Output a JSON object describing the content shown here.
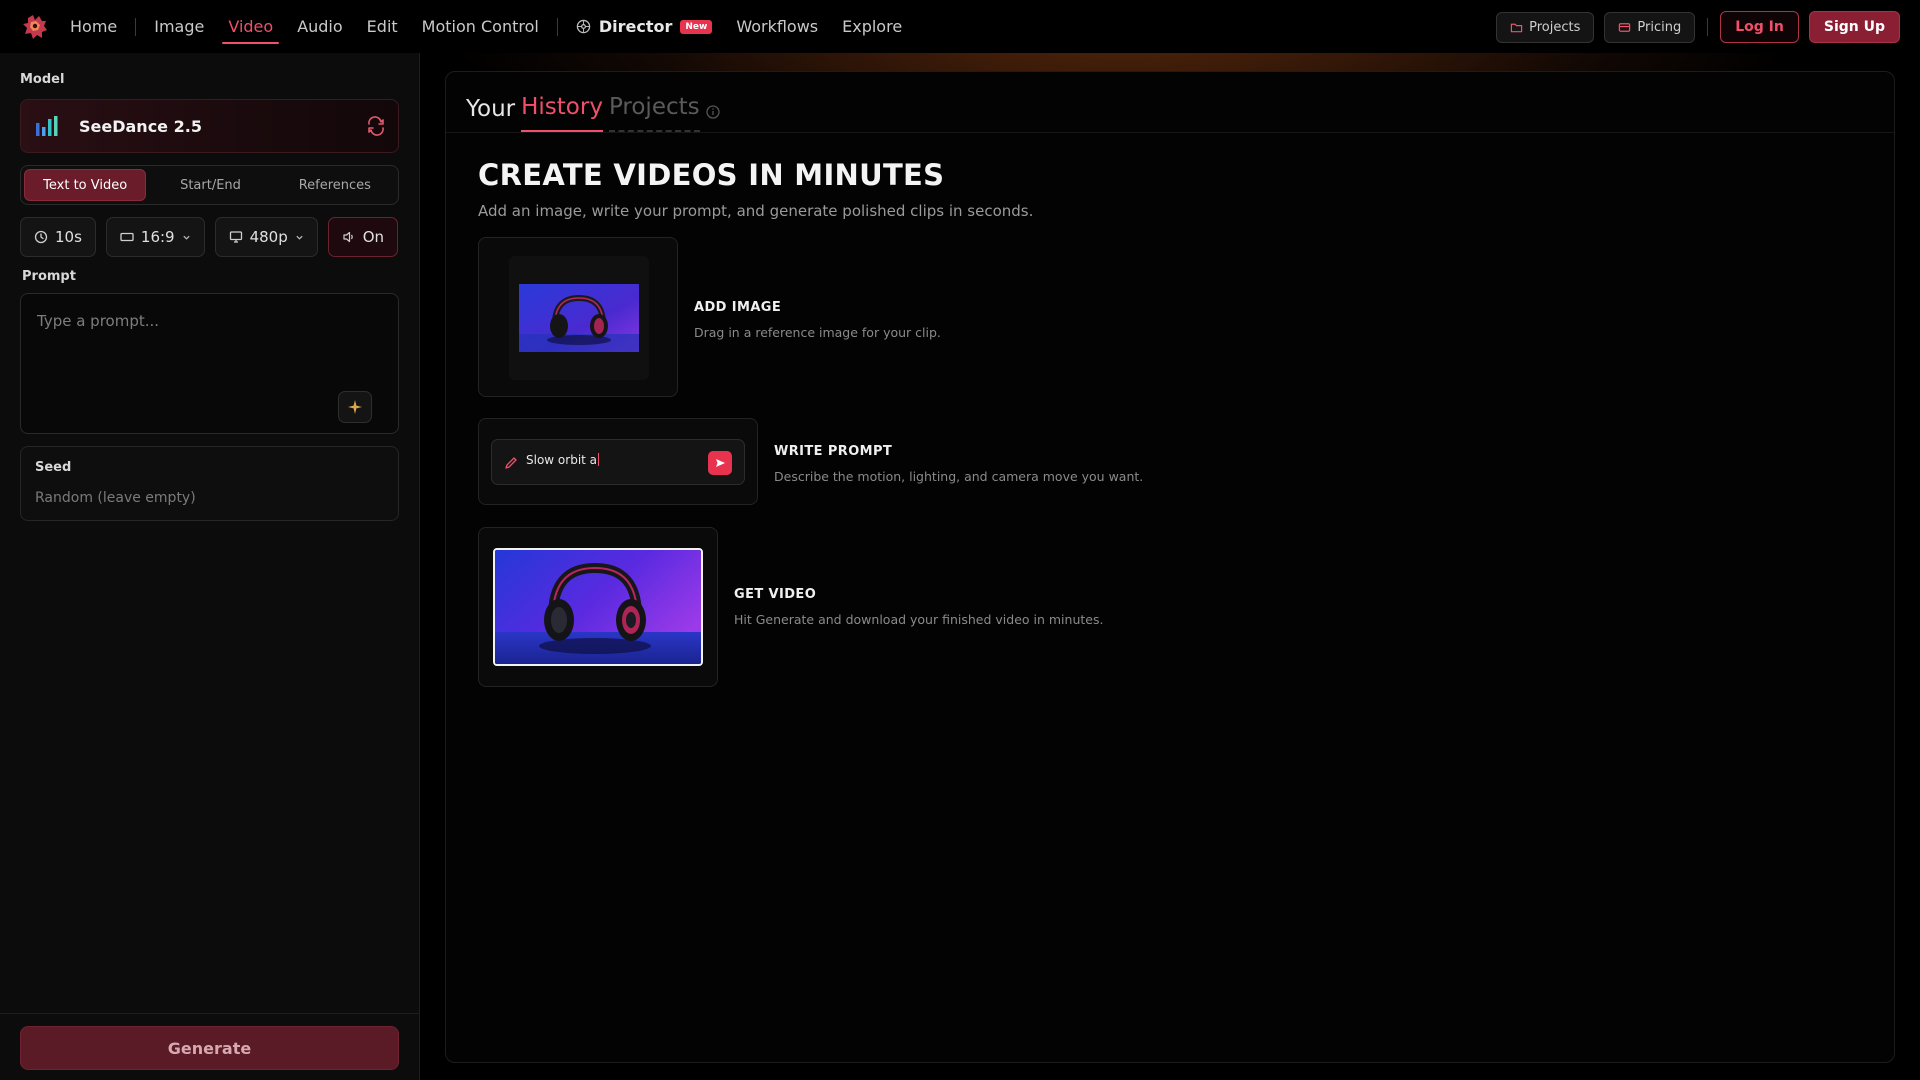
{
  "nav": {
    "items": [
      {
        "label": "Home",
        "active": false
      },
      {
        "label": "Image",
        "active": false
      },
      {
        "label": "Video",
        "active": true
      },
      {
        "label": "Audio",
        "active": false
      },
      {
        "label": "Edit",
        "active": false
      },
      {
        "label": "Motion Control",
        "active": false
      }
    ],
    "director_label": "Director",
    "director_badge": "New",
    "workflows_label": "Workflows",
    "explore_label": "Explore",
    "projects_label": "Projects",
    "pricing_label": "Pricing",
    "login_label": "Log In",
    "signup_label": "Sign Up",
    "accent_color": "#f0506a"
  },
  "sidebar": {
    "model_label": "Model",
    "model_name": "SeeDance 2.5",
    "mode_tabs": [
      {
        "label": "Text to Video",
        "active": true
      },
      {
        "label": "Start/End",
        "active": false
      },
      {
        "label": "References",
        "active": false
      }
    ],
    "duration": "10s",
    "aspect_ratio": "16:9",
    "resolution": "480p",
    "audio": "On",
    "prompt_label": "Prompt",
    "prompt_placeholder": "Type a prompt...",
    "seed_label": "Seed",
    "seed_placeholder": "Random (leave empty)",
    "generate_label": "Generate"
  },
  "main": {
    "tabs": {
      "your": "Your",
      "history": "History",
      "projects": "Projects"
    },
    "hero_title": "CREATE VIDEOS IN MINUTES",
    "hero_subtitle": "Add an image, write your prompt, and generate polished clips in seconds.",
    "steps": [
      {
        "title": "ADD IMAGE",
        "desc": "Drag in a reference image for your clip."
      },
      {
        "title": "WRITE PROMPT",
        "desc": "Describe the motion, lighting, and camera move you want.",
        "typed_text": "Slow orbit a"
      },
      {
        "title": "GET VIDEO",
        "desc": "Hit Generate and download your finished video in minutes."
      }
    ]
  }
}
